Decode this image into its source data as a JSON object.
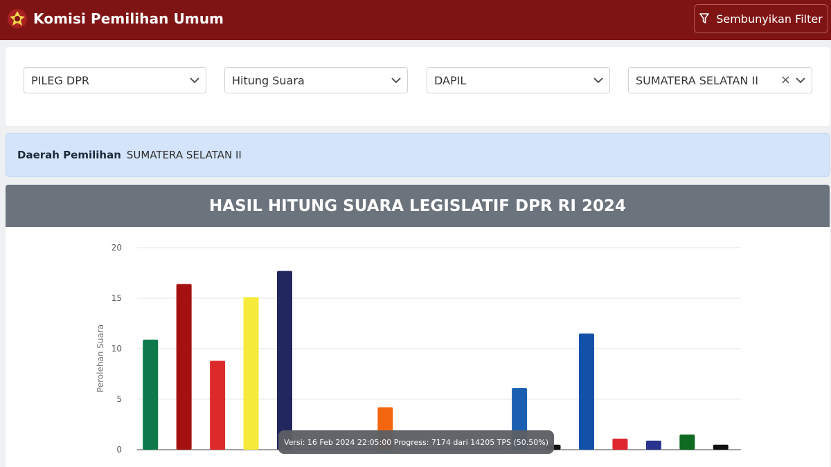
{
  "header": {
    "title": "Komisi Pemilihan Umum",
    "filter_button": "Sembunyikan Filter"
  },
  "filters": [
    {
      "value": "PILEG DPR"
    },
    {
      "value": "Hitung Suara"
    },
    {
      "value": "DAPIL"
    },
    {
      "value": "SUMATERA SELATAN II",
      "clear": "×"
    }
  ],
  "dapil": {
    "label": "Daerah Pemilihan",
    "value": "SUMATERA SELATAN II"
  },
  "chart": {
    "title": "HASIL HITUNG SUARA LEGISLATIF DPR RI 2024",
    "tooltip": "Versi: 16 Feb 2024 22:05:00 Progress: 7174 dari 14205 TPS (50.50%)"
  },
  "colors": {
    "brand": "#7f1414",
    "header_band": "#6b737d",
    "info_bar": "#d4e5fb"
  },
  "chart_data": {
    "type": "bar",
    "title": "HASIL HITUNG SUARA LEGISLATIF DPR RI 2024",
    "ylabel": "Perolehan Suara",
    "ylim": [
      0,
      20
    ],
    "yticks": [
      0,
      5,
      10,
      15,
      20
    ],
    "grid": true,
    "values": [
      10.9,
      16.4,
      8.8,
      15.1,
      17.7,
      0,
      0,
      4.2,
      0,
      0,
      0,
      6.1,
      0.5,
      11.5,
      1.1,
      0.9,
      1.5,
      0.5
    ],
    "colors": [
      "#0e7a4c",
      "#a51010",
      "#dc2a2a",
      "#f6ea3a",
      "#22275f",
      "#cccccc",
      "#cccccc",
      "#f4670e",
      "#cccccc",
      "#cccccc",
      "#cccccc",
      "#1b60b0",
      "#111111",
      "#1351a8",
      "#e0262e",
      "#29348f",
      "#0f6a22",
      "#111111"
    ]
  }
}
